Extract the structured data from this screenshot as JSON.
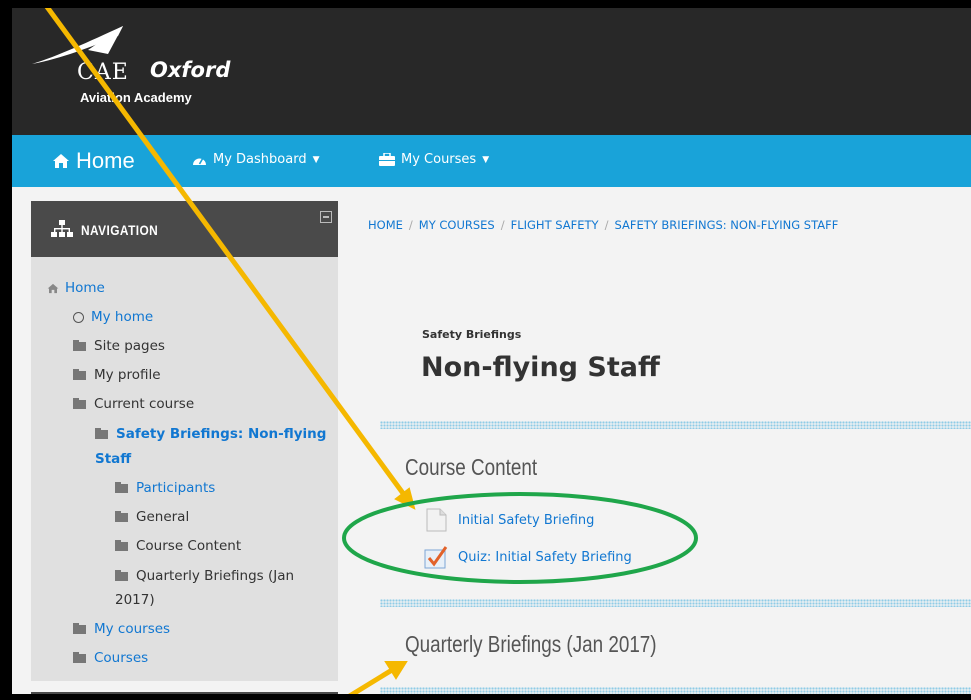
{
  "header": {
    "logo_brand": "CAE",
    "logo_name": "Oxford",
    "logo_subtitle": "Aviation Academy"
  },
  "navbar": {
    "home_label": "Home",
    "dashboard_label": "My Dashboard",
    "courses_label": "My Courses"
  },
  "navigation": {
    "title": "NAVIGATION",
    "items": [
      {
        "label": "Home"
      },
      {
        "label": "My home"
      },
      {
        "label": "Site pages"
      },
      {
        "label": "My profile"
      },
      {
        "label": "Current course"
      },
      {
        "label_line1": "Safety Briefings: Non-flying",
        "label_line2": "Staff"
      },
      {
        "label": "Participants"
      },
      {
        "label": "General"
      },
      {
        "label": "Course Content"
      },
      {
        "label_line1": "Quarterly Briefings (Jan",
        "label_line2": "2017)"
      },
      {
        "label": "My courses"
      },
      {
        "label": "Courses"
      }
    ]
  },
  "breadcrumb": [
    "HOME",
    "MY COURSES",
    "FLIGHT SAFETY",
    "SAFETY BRIEFINGS: NON-FLYING STAFF"
  ],
  "course": {
    "short_name": "Safety Briefings",
    "title": "Non-flying Staff"
  },
  "sections": [
    {
      "title": "Course Content",
      "activities": [
        {
          "label": "Initial Safety Briefing",
          "icon": "page-icon"
        },
        {
          "label": "Quiz: Initial Safety Briefing",
          "icon": "quiz-icon"
        }
      ]
    },
    {
      "title": "Quarterly Briefings (Jan 2017)",
      "activities": []
    }
  ],
  "colors": {
    "navbar": "#19a3d9",
    "header": "#282828",
    "link": "#1177d1",
    "annotation_arrow": "#f5b800",
    "annotation_circle": "#1fa64a"
  }
}
